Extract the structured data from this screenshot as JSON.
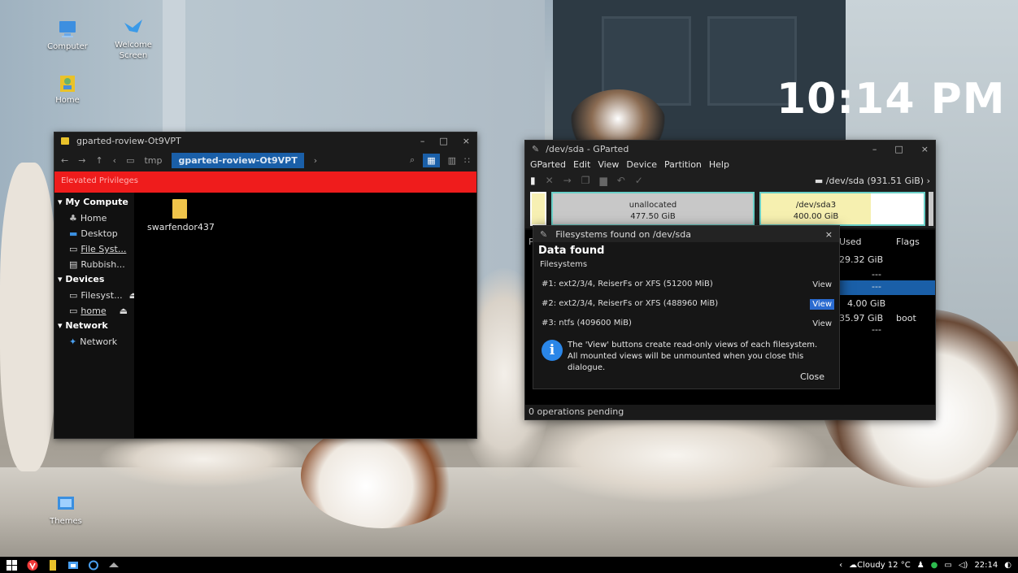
{
  "desktop": {
    "clock": "10:14 PM",
    "icons": [
      {
        "label": "Computer"
      },
      {
        "label": "Welcome Screen"
      },
      {
        "label": "Home"
      },
      {
        "label": "Themes"
      }
    ]
  },
  "file_manager": {
    "title": "gparted-roview-Ot9VPT",
    "window_controls": [
      "–",
      "□",
      "×"
    ],
    "breadcrumbs": [
      "tmp",
      "gparted-roview-Ot9VPT"
    ],
    "elevated_banner": "Elevated Privileges",
    "sidebar": {
      "sections": [
        {
          "title": "My Compute",
          "items": [
            "Home",
            "Desktop",
            "File Syst...",
            "Rubbish..."
          ]
        },
        {
          "title": "Devices",
          "items": [
            "Filesyst...",
            "home"
          ]
        },
        {
          "title": "Network",
          "items": [
            "Network"
          ]
        }
      ]
    },
    "files": [
      {
        "name": "swarfendor437"
      }
    ]
  },
  "gparted": {
    "title": "/dev/sda - GParted",
    "menu": [
      "GParted",
      "Edit",
      "View",
      "Device",
      "Partition",
      "Help"
    ],
    "device": "/dev/sda  (931.51 GiB)",
    "map": [
      {
        "label": "unallocated",
        "size": "477.50 GiB"
      },
      {
        "label": "/dev/sda3",
        "size": "400.00 GiB"
      }
    ],
    "columns": {
      "used": "Used",
      "flags": "Flags",
      "partition_short": "Pa"
    },
    "rows": [
      {
        "used": "29.32 GiB",
        "flags": ""
      },
      {
        "used": "---",
        "flags": ""
      },
      {
        "used": "---",
        "flags": ""
      },
      {
        "used": "4.00 GiB",
        "flags": ""
      },
      {
        "used": "35.97 GiB",
        "flags": "boot"
      },
      {
        "used": "---",
        "flags": ""
      }
    ],
    "status": "0 operations pending"
  },
  "dialog": {
    "title": "Filesystems found on /dev/sda",
    "heading": "Data found",
    "subheading": "Filesystems",
    "filesystems": [
      {
        "text": "#1: ext2/3/4, ReiserFs or XFS (51200 MiB)",
        "button": "View"
      },
      {
        "text": "#2: ext2/3/4, ReiserFs or XFS (488960 MiB)",
        "button": "View"
      },
      {
        "text": "#3: ntfs (409600 MiB)",
        "button": "View"
      }
    ],
    "info_line1": "The 'View' buttons create read-only views of each filesystem.",
    "info_line2": "All mounted views will be unmounted when you close this dialogue.",
    "close": "Close"
  },
  "taskbar": {
    "weather": "Cloudy 12 °C",
    "time": "22:14"
  }
}
